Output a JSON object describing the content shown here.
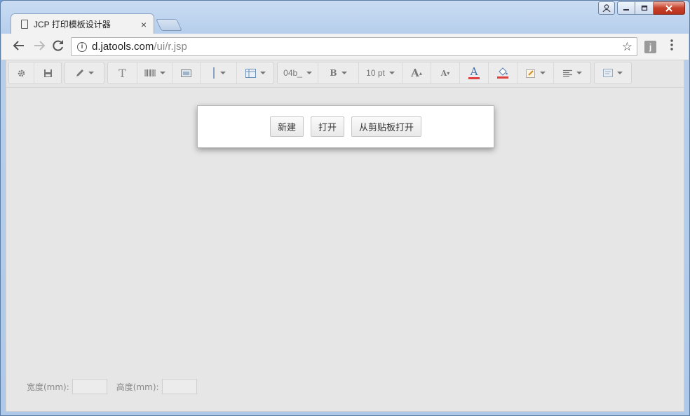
{
  "browser": {
    "tab_title": "JCP 打印模板设计器",
    "tab_close": "×",
    "url_host": "d.jatools.com",
    "url_path": "/ui/r.jsp",
    "extension_letter": "j"
  },
  "toolbar": {
    "font_name": "04b_",
    "bold_label": "B",
    "font_size": "10 pt",
    "text_tool": "T",
    "increase_font": "A",
    "decrease_font": "A",
    "font_color": "A",
    "underline_color": "#e04040"
  },
  "dialog": {
    "new_label": "新建",
    "open_label": "打开",
    "clipboard_open_label": "从剪贴板打开"
  },
  "dimensions": {
    "width_label": "宽度(mm):",
    "height_label": "高度(mm):",
    "width_value": "",
    "height_value": ""
  }
}
